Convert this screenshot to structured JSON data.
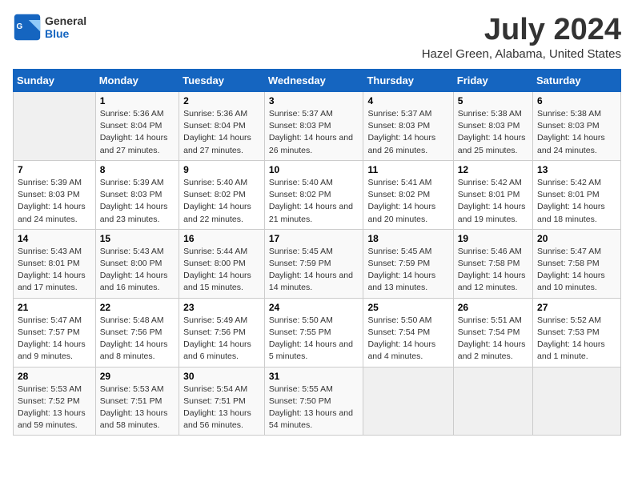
{
  "header": {
    "logo_general": "General",
    "logo_blue": "Blue",
    "title": "July 2024",
    "subtitle": "Hazel Green, Alabama, United States"
  },
  "days_of_week": [
    "Sunday",
    "Monday",
    "Tuesday",
    "Wednesday",
    "Thursday",
    "Friday",
    "Saturday"
  ],
  "weeks": [
    [
      {
        "num": "",
        "info": ""
      },
      {
        "num": "1",
        "info": "Sunrise: 5:36 AM\nSunset: 8:04 PM\nDaylight: 14 hours\nand 27 minutes."
      },
      {
        "num": "2",
        "info": "Sunrise: 5:36 AM\nSunset: 8:04 PM\nDaylight: 14 hours\nand 27 minutes."
      },
      {
        "num": "3",
        "info": "Sunrise: 5:37 AM\nSunset: 8:03 PM\nDaylight: 14 hours\nand 26 minutes."
      },
      {
        "num": "4",
        "info": "Sunrise: 5:37 AM\nSunset: 8:03 PM\nDaylight: 14 hours\nand 26 minutes."
      },
      {
        "num": "5",
        "info": "Sunrise: 5:38 AM\nSunset: 8:03 PM\nDaylight: 14 hours\nand 25 minutes."
      },
      {
        "num": "6",
        "info": "Sunrise: 5:38 AM\nSunset: 8:03 PM\nDaylight: 14 hours\nand 24 minutes."
      }
    ],
    [
      {
        "num": "7",
        "info": "Sunrise: 5:39 AM\nSunset: 8:03 PM\nDaylight: 14 hours\nand 24 minutes."
      },
      {
        "num": "8",
        "info": "Sunrise: 5:39 AM\nSunset: 8:03 PM\nDaylight: 14 hours\nand 23 minutes."
      },
      {
        "num": "9",
        "info": "Sunrise: 5:40 AM\nSunset: 8:02 PM\nDaylight: 14 hours\nand 22 minutes."
      },
      {
        "num": "10",
        "info": "Sunrise: 5:40 AM\nSunset: 8:02 PM\nDaylight: 14 hours\nand 21 minutes."
      },
      {
        "num": "11",
        "info": "Sunrise: 5:41 AM\nSunset: 8:02 PM\nDaylight: 14 hours\nand 20 minutes."
      },
      {
        "num": "12",
        "info": "Sunrise: 5:42 AM\nSunset: 8:01 PM\nDaylight: 14 hours\nand 19 minutes."
      },
      {
        "num": "13",
        "info": "Sunrise: 5:42 AM\nSunset: 8:01 PM\nDaylight: 14 hours\nand 18 minutes."
      }
    ],
    [
      {
        "num": "14",
        "info": "Sunrise: 5:43 AM\nSunset: 8:01 PM\nDaylight: 14 hours\nand 17 minutes."
      },
      {
        "num": "15",
        "info": "Sunrise: 5:43 AM\nSunset: 8:00 PM\nDaylight: 14 hours\nand 16 minutes."
      },
      {
        "num": "16",
        "info": "Sunrise: 5:44 AM\nSunset: 8:00 PM\nDaylight: 14 hours\nand 15 minutes."
      },
      {
        "num": "17",
        "info": "Sunrise: 5:45 AM\nSunset: 7:59 PM\nDaylight: 14 hours\nand 14 minutes."
      },
      {
        "num": "18",
        "info": "Sunrise: 5:45 AM\nSunset: 7:59 PM\nDaylight: 14 hours\nand 13 minutes."
      },
      {
        "num": "19",
        "info": "Sunrise: 5:46 AM\nSunset: 7:58 PM\nDaylight: 14 hours\nand 12 minutes."
      },
      {
        "num": "20",
        "info": "Sunrise: 5:47 AM\nSunset: 7:58 PM\nDaylight: 14 hours\nand 10 minutes."
      }
    ],
    [
      {
        "num": "21",
        "info": "Sunrise: 5:47 AM\nSunset: 7:57 PM\nDaylight: 14 hours\nand 9 minutes."
      },
      {
        "num": "22",
        "info": "Sunrise: 5:48 AM\nSunset: 7:56 PM\nDaylight: 14 hours\nand 8 minutes."
      },
      {
        "num": "23",
        "info": "Sunrise: 5:49 AM\nSunset: 7:56 PM\nDaylight: 14 hours\nand 6 minutes."
      },
      {
        "num": "24",
        "info": "Sunrise: 5:50 AM\nSunset: 7:55 PM\nDaylight: 14 hours\nand 5 minutes."
      },
      {
        "num": "25",
        "info": "Sunrise: 5:50 AM\nSunset: 7:54 PM\nDaylight: 14 hours\nand 4 minutes."
      },
      {
        "num": "26",
        "info": "Sunrise: 5:51 AM\nSunset: 7:54 PM\nDaylight: 14 hours\nand 2 minutes."
      },
      {
        "num": "27",
        "info": "Sunrise: 5:52 AM\nSunset: 7:53 PM\nDaylight: 14 hours\nand 1 minute."
      }
    ],
    [
      {
        "num": "28",
        "info": "Sunrise: 5:53 AM\nSunset: 7:52 PM\nDaylight: 13 hours\nand 59 minutes."
      },
      {
        "num": "29",
        "info": "Sunrise: 5:53 AM\nSunset: 7:51 PM\nDaylight: 13 hours\nand 58 minutes."
      },
      {
        "num": "30",
        "info": "Sunrise: 5:54 AM\nSunset: 7:51 PM\nDaylight: 13 hours\nand 56 minutes."
      },
      {
        "num": "31",
        "info": "Sunrise: 5:55 AM\nSunset: 7:50 PM\nDaylight: 13 hours\nand 54 minutes."
      },
      {
        "num": "",
        "info": ""
      },
      {
        "num": "",
        "info": ""
      },
      {
        "num": "",
        "info": ""
      }
    ]
  ]
}
